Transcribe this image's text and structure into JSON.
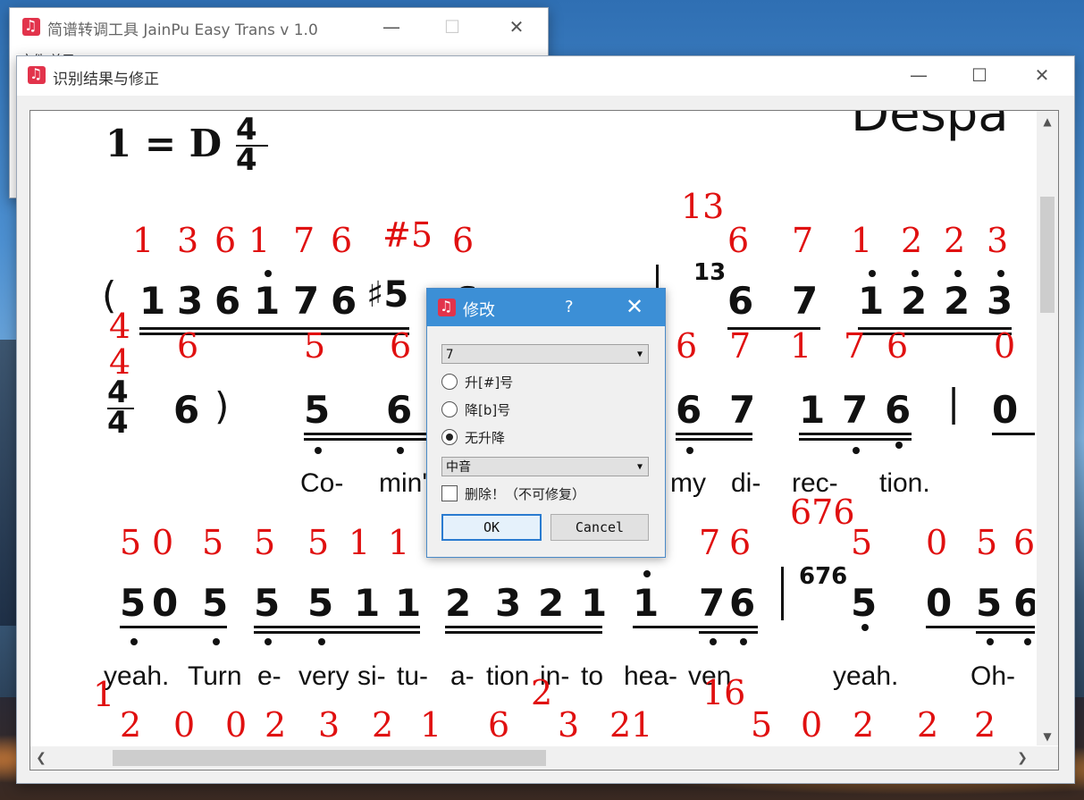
{
  "main_window": {
    "title": "简谱转调工具 JainPu Easy Trans v 1.0",
    "menu_text": "文件 关于"
  },
  "result_window": {
    "title": "识别结果与修正"
  },
  "score": {
    "key_signature": "1 = D",
    "time_sig_top": "4",
    "time_sig_bottom": "4",
    "header_partial": "Despa",
    "row1_notes": [
      "(",
      "1",
      "3",
      "6",
      "1",
      "7",
      "6",
      "♯5",
      "6",
      "13",
      "6",
      "7",
      "1",
      "2",
      "2",
      "3"
    ],
    "row1_red_top": [
      "1",
      "3",
      "6",
      "1",
      "7",
      "6",
      "#5",
      "6",
      "13",
      "6",
      "7",
      "1",
      "2",
      "2",
      "3"
    ],
    "row1_red_bottom": [
      "4",
      "6",
      "5",
      "6",
      "6",
      "7",
      "1",
      "7",
      "6",
      "0"
    ],
    "row2_notes": [
      "4",
      "4",
      "6",
      ")",
      "5",
      "6",
      "6",
      "7",
      "1",
      "7",
      "6",
      "|",
      "0"
    ],
    "row2_red": [
      "4"
    ],
    "row2_lyrics": [
      "Co-",
      "min'",
      "my",
      "di-",
      "rec-",
      "tion."
    ],
    "row3_red": [
      "5",
      "0",
      "5",
      "5",
      "5",
      "1",
      "1",
      "7",
      "6",
      "676",
      "5",
      "0",
      "5",
      "6"
    ],
    "row3_notes": [
      "5",
      "0",
      "5",
      "5",
      "5",
      "1",
      "1",
      "2",
      "3",
      "2",
      "1",
      "1",
      "7",
      "6",
      "676",
      "5",
      "0",
      "5",
      "6"
    ],
    "row3_lyrics": [
      "yeah.",
      "Turn",
      "e-",
      "very",
      "si-",
      "tu-",
      "a-",
      "tion",
      "in-",
      "to",
      "hea-",
      "ven",
      "yeah.",
      "Oh-"
    ],
    "row4_red": [
      "1",
      "2",
      "0",
      "0",
      "2",
      "3",
      "2",
      "1",
      "6",
      "2",
      "3",
      "21",
      "16",
      "5",
      "0",
      "2",
      "2",
      "2"
    ]
  },
  "dialog": {
    "title": "修改",
    "help": "?",
    "close": "✕",
    "note_value": "7",
    "radio_sharp": "升[#]号",
    "radio_flat": "降[b]号",
    "radio_none": "无升降",
    "selected_radio": "无升降",
    "octave_value": "中音",
    "delete_label": "删除！（不可修复）",
    "ok_label": "OK",
    "cancel_label": "Cancel"
  },
  "colors": {
    "dialog_title": "#3c8fd6",
    "annotation_red": "#e01010",
    "annotation_blue": "#2020d0"
  }
}
